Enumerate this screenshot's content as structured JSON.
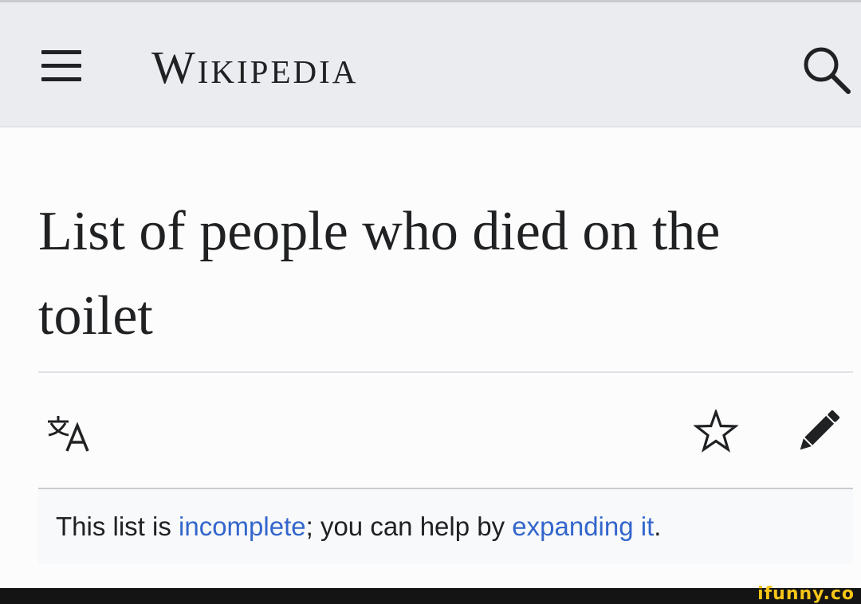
{
  "header": {
    "logo_text": "Wikipedia",
    "menu_icon": "hamburger-menu-icon",
    "search_icon": "search-icon",
    "background_color": "#eaecf0"
  },
  "article": {
    "title": "List of people who died on the toilet"
  },
  "actions": {
    "language_icon": "translate-language-icon",
    "watch_icon": "star-watch-icon",
    "edit_icon": "pencil-edit-icon"
  },
  "notice": {
    "text_before": "This list is ",
    "link1": "incomplete",
    "text_middle": "; you can help by ",
    "link2": "expanding it",
    "text_after": ".",
    "link_color": "#3366cc"
  },
  "watermark": {
    "text": "ifunny.co",
    "color": "#f5c518"
  }
}
